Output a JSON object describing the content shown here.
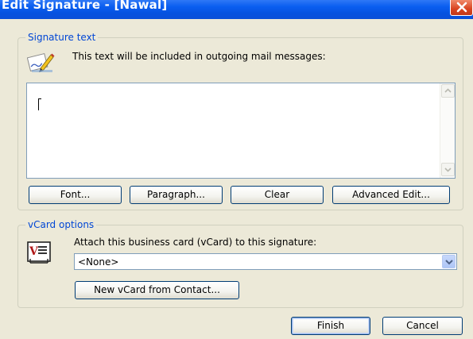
{
  "window": {
    "title": "Edit Signature - [Nawal]",
    "close_label": "×"
  },
  "signature_group": {
    "legend": "Signature text",
    "instruction": "This text will be included in outgoing mail messages:",
    "editor_value": "",
    "buttons": {
      "font": "Font...",
      "paragraph": "Paragraph...",
      "clear": "Clear",
      "advanced_edit": "Advanced Edit..."
    }
  },
  "vcard_group": {
    "legend": "vCard options",
    "instruction": "Attach this business card (vCard) to this signature:",
    "selected": "<None>",
    "new_vcard_button": "New vCard from Contact..."
  },
  "footer": {
    "finish": "Finish",
    "cancel": "Cancel"
  },
  "icons": {
    "signature": "pen-signature-icon",
    "vcard": "vcard-icon",
    "close": "close-icon",
    "scroll_up": "scroll-up-arrow-icon",
    "scroll_down": "scroll-down-arrow-icon",
    "dropdown": "chevron-down-icon"
  },
  "colors": {
    "titlebar": "#0a5ef0",
    "dialog_bg": "#ece9d8",
    "group_legend": "#0046d5",
    "close_button": "#d8431f"
  }
}
